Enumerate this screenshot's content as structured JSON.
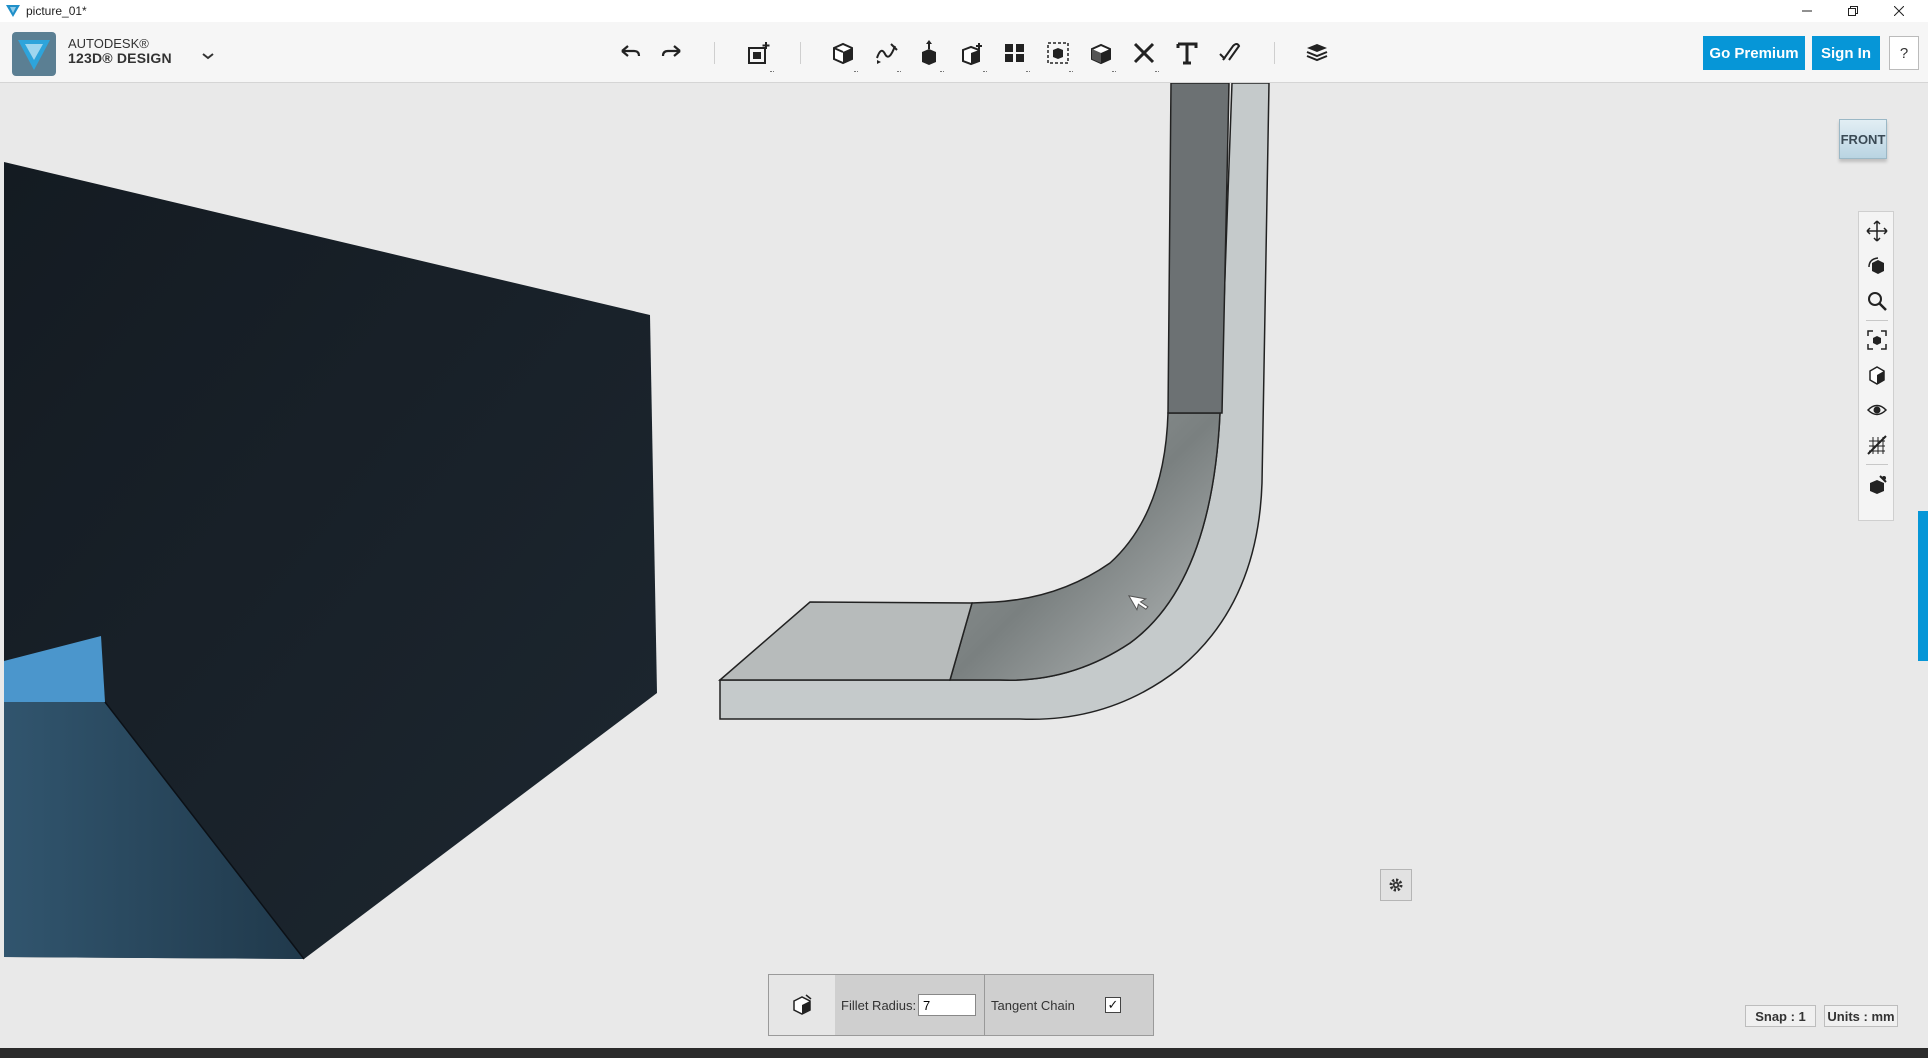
{
  "window": {
    "title": "picture_01*",
    "controls": [
      "minimize",
      "restore",
      "close"
    ]
  },
  "brand": {
    "line1": "AUTODESK®",
    "line2": "123D® DESIGN"
  },
  "toolbar": {
    "tools": [
      {
        "name": "undo",
        "icon": "undo-icon"
      },
      {
        "name": "redo",
        "icon": "redo-icon"
      },
      {
        "name": "transform",
        "icon": "transform-icon"
      },
      {
        "name": "primitives",
        "icon": "primitives-box-icon"
      },
      {
        "name": "sketch",
        "icon": "sketch-icon"
      },
      {
        "name": "construct",
        "icon": "construct-icon"
      },
      {
        "name": "modify",
        "icon": "modify-icon"
      },
      {
        "name": "pattern",
        "icon": "pattern-icon"
      },
      {
        "name": "grouping",
        "icon": "grouping-icon"
      },
      {
        "name": "combine",
        "icon": "combine-icon"
      },
      {
        "name": "measure",
        "icon": "measure-icon"
      },
      {
        "name": "text",
        "icon": "text-icon"
      },
      {
        "name": "snap",
        "icon": "snap-icon"
      },
      {
        "name": "material",
        "icon": "layers-icon"
      }
    ],
    "premium_label": "Go Premium",
    "signin_label": "Sign In",
    "help_label": "?"
  },
  "viewcube": {
    "face_label": "FRONT"
  },
  "navbar": {
    "items": [
      "pan-icon",
      "orbit-icon",
      "zoom-icon",
      "fit-icon",
      "perspective-icon",
      "visibility-icon",
      "hide-grid-icon",
      "material-view-icon"
    ]
  },
  "fillet": {
    "radius_label": "Fillet Radius:",
    "radius_value": "7",
    "tangent_label": "Tangent Chain",
    "tangent_checked": true,
    "check_glyph": "✓"
  },
  "status": {
    "snap": "Snap : 1",
    "units": "Units : mm"
  },
  "colors": {
    "accent": "#0696d7",
    "viewport_bg": "#e9e9e9",
    "dark_solid": "#17202a",
    "selected_face": "#4b96cc",
    "part_light": "#c7ccce"
  }
}
